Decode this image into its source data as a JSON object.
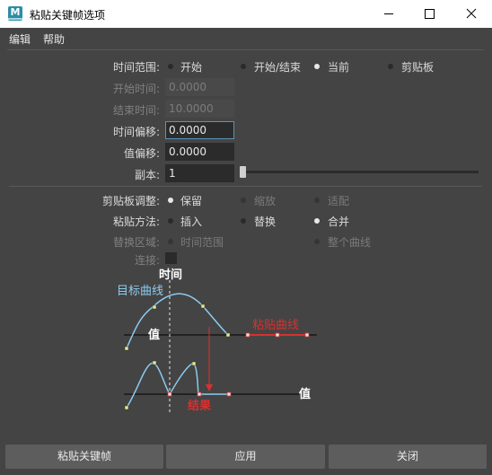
{
  "window": {
    "title": "粘贴关键帧选项",
    "icon_letter": "M",
    "controls": [
      "minimize-icon",
      "maximize-icon",
      "close-icon"
    ]
  },
  "menu": [
    "编辑",
    "帮助"
  ],
  "time_range": {
    "label": "时间范围:",
    "options": [
      {
        "label": "开始",
        "selected": false
      },
      {
        "label": "开始/结束",
        "selected": false
      },
      {
        "label": "当前",
        "selected": true
      },
      {
        "label": "剪贴板",
        "selected": false
      }
    ]
  },
  "start_time": {
    "label": "开始时间:",
    "value": "0.0000"
  },
  "end_time": {
    "label": "结束时间:",
    "value": "10.0000"
  },
  "time_offset": {
    "label": "时间偏移:",
    "value": "0.0000"
  },
  "value_offset": {
    "label": "值偏移:",
    "value": "0.0000"
  },
  "copies": {
    "label": "副本:",
    "value": "1"
  },
  "clipboard_adjust": {
    "label": "剪贴板调整:",
    "options": [
      {
        "label": "保留",
        "selected": true
      },
      {
        "label": "缩放",
        "selected": false
      },
      {
        "label": "适配",
        "selected": false
      }
    ]
  },
  "paste_method": {
    "label": "粘贴方法:",
    "options": [
      {
        "label": "插入",
        "selected": false
      },
      {
        "label": "替换",
        "selected": false
      },
      {
        "label": "合并",
        "selected": true
      }
    ]
  },
  "replace_region": {
    "label": "替换区域:",
    "options": [
      {
        "label": "时间范围",
        "selected": false
      },
      {
        "label": "整个曲线",
        "selected": false
      }
    ]
  },
  "connect": {
    "label": "连接:",
    "checked": false
  },
  "diagram": {
    "time_label": "时间",
    "target_curve": "目标曲线",
    "value_label_top": "值",
    "paste_curve": "粘贴曲线",
    "value_label_bottom": "值",
    "result": "结果",
    "colors": {
      "curve": "#8ccbf0",
      "paste": "#d93030",
      "key": "#e6ea8a"
    }
  },
  "buttons": {
    "paste_keys": "粘贴关键帧",
    "apply": "应用",
    "close": "关闭"
  }
}
